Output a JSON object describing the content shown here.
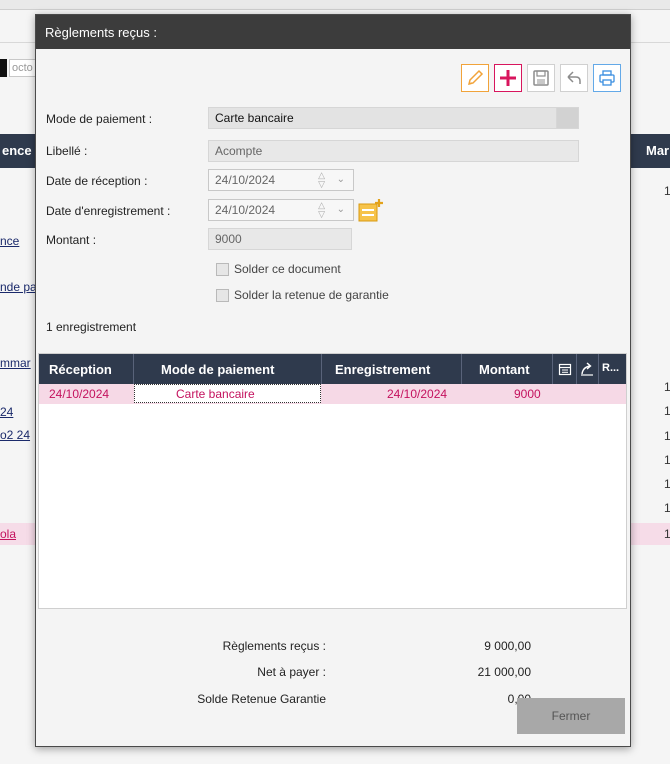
{
  "background": {
    "input_text": "octo",
    "header_left": "ence",
    "header_right": "Mar",
    "links": [
      "nce",
      "nde pa",
      "mmar",
      "24",
      "o2 24"
    ],
    "selected_link": "ola",
    "right_digit": "1"
  },
  "dialog": {
    "title": "Règlements reçus :",
    "toolbar": {
      "edit_icon": "pencil-icon",
      "add_icon": "plus-icon",
      "save_icon": "floppy-disk-icon",
      "undo_icon": "undo-arrow-icon",
      "print_icon": "printer-icon"
    },
    "form": {
      "payment_mode_label": "Mode de paiement :",
      "payment_mode_value": "Carte bancaire",
      "libelle_label": "Libellé :",
      "libelle_value": "Acompte",
      "reception_date_label": "Date de réception :",
      "reception_date_value": "24/10/2024",
      "registration_date_label": "Date d'enregistrement :",
      "registration_date_value": "24/10/2024",
      "amount_label": "Montant :",
      "amount_value": "9000",
      "checkbox_settle_doc": "Solder ce document",
      "checkbox_settle_retention": "Solder la retenue de garantie"
    },
    "record_count": "1 enregistrement",
    "grid": {
      "columns": [
        "Réception",
        "Mode de paiement",
        "Enregistrement",
        "Montant",
        "R..."
      ],
      "rows": [
        {
          "reception": "24/10/2024",
          "mode": "Carte bancaire",
          "enregistrement": "24/10/2024",
          "montant": "9000"
        }
      ]
    },
    "summary": {
      "received_label": "Règlements reçus :",
      "received_value": "9 000,00",
      "net_label": "Net à payer :",
      "net_value": "21 000,00",
      "retention_label": "Solde Retenue Garantie",
      "retention_value": "0,00"
    },
    "close_label": "Fermer"
  }
}
